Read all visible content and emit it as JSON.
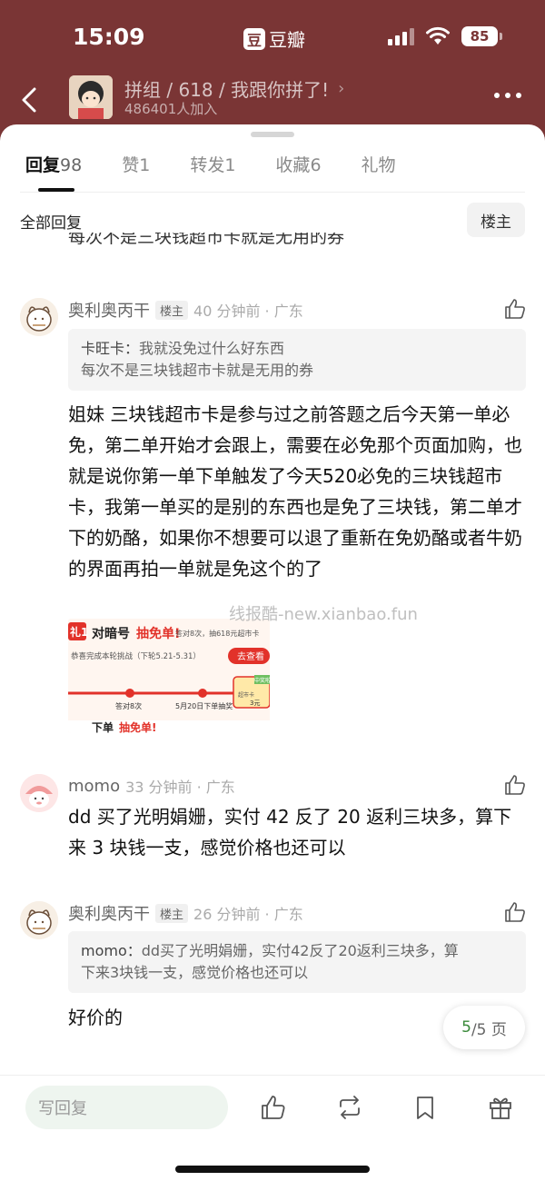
{
  "status": {
    "time": "15:09",
    "app_badge": "豆",
    "app_name": "豆瓣",
    "battery": "85"
  },
  "header": {
    "title": "拼组 / 618 / 我跟你拼了!",
    "members": "486401人加入"
  },
  "tabs": [
    {
      "label": "回复",
      "count": "98",
      "active": true
    },
    {
      "label": "赞",
      "count": "1"
    },
    {
      "label": "转发",
      "count": "1"
    },
    {
      "label": "收藏",
      "count": "6"
    },
    {
      "label": "礼物",
      "count": ""
    }
  ],
  "filter": {
    "title": "全部回复",
    "op_button": "楼主"
  },
  "cut_text": "每次不是三块钱超市卡就是无用的券",
  "comments": [
    {
      "name": "奥利奥丙干",
      "tag": "楼主",
      "time": "40 分钟前 · 广东",
      "quote_author": "卡旺卡：",
      "quote_line1": "我就没免过什么好东西",
      "quote_line2": "每次不是三块钱超市卡就是无用的券",
      "body": "姐妹 三块钱超市卡是参与过之前答题之后今天第一单必免，第二单开始才会跟上，需要在必免那个页面加购，也就是说你第一单下单触发了今天520必免的三块钱超市卡，我第一单买的是别的东西也是免了三块钱，第二单才下的奶酪，如果你不想要可以退了重新在免奶酪或者牛奶的界面再拍一单就是免这个的了"
    },
    {
      "name": "momo",
      "time": "33 分钟前 · 广东",
      "body": "dd 买了光明娟姗，实付 42 反了 20 返利三块多，算下来 3 块钱一支，感觉价格也还可以"
    },
    {
      "name": "奥利奥丙干",
      "tag": "楼主",
      "time": "26 分钟前 · 广东",
      "quote_author": "momo：",
      "quote_line1": "dd买了光明娟姗，实付42反了20返利三块多，算",
      "quote_line2": "下来3块钱一支，感觉价格也还可以",
      "body": "好价的"
    }
  ],
  "image": {
    "badge": "礼1",
    "title_prefix": "对暗号",
    "title_em": "抽免单!",
    "title_suffix": "答对8次，抽618元超市卡",
    "subtitle": "恭喜完成本轮挑战（下轮5.21-5.31）",
    "button": "去查看",
    "step1": "答对8次",
    "step2": "5月20日下单抽奖",
    "prize_tag": "中奖啦",
    "prize_name": "超市卡",
    "prize_value": "3元",
    "bottom_prefix": "下单",
    "bottom_em": "抽免单!"
  },
  "watermark": "线报酷-new.xianbao.fun",
  "pager": {
    "current": "5",
    "total": "/5 页"
  },
  "bottom": {
    "reply_placeholder": "写回复"
  },
  "colors": {
    "header_bg": "#7a3535",
    "accent_green": "#3a8a3a",
    "image_red": "#e2322a"
  },
  "icons": [
    "back-arrow-icon",
    "chevron-right-icon",
    "more-dots-icon",
    "thumbs-up-icon",
    "repost-icon",
    "bookmark-icon",
    "gift-icon"
  ]
}
